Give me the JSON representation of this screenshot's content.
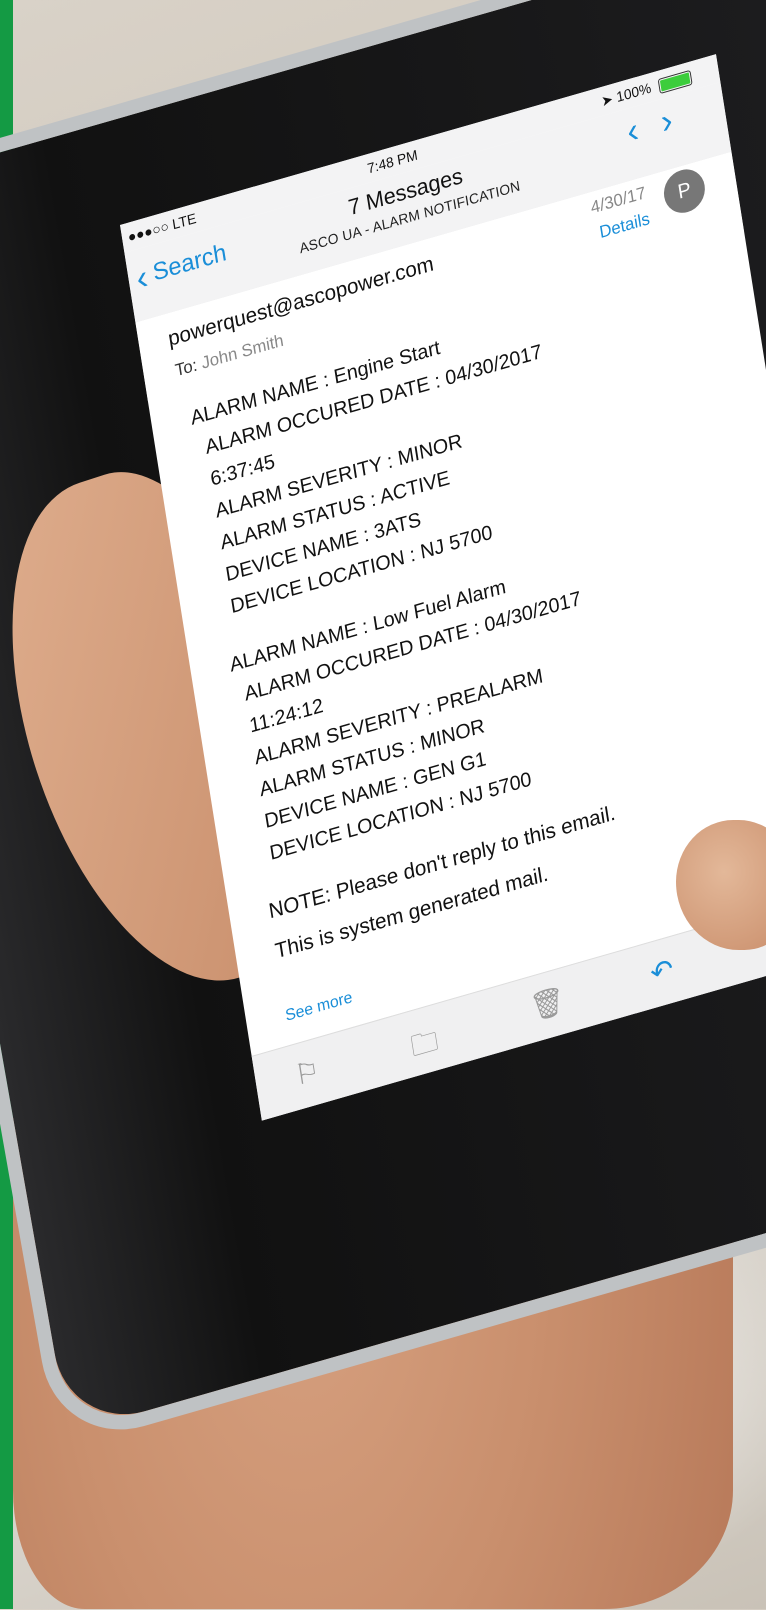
{
  "status_bar": {
    "carrier": "●●●○○ LTE",
    "time": "7:48 PM",
    "battery": "100%"
  },
  "nav": {
    "back_label": "Search",
    "title": "7 Messages",
    "subtitle": "ASCO UA - ALARM NOTIFICATION"
  },
  "email": {
    "sender": "powerquest@ascopower.com",
    "to_label": "To:",
    "to_name": "John Smith",
    "date": "4/30/17",
    "details_label": "Details",
    "avatar_initial": "P",
    "alarms": [
      {
        "name": "ALARM NAME : Engine Start",
        "occurred": "ALARM OCCURED DATE : 04/30/2017",
        "time": "6:37:45",
        "severity": "ALARM SEVERITY : MINOR",
        "status": "ALARM STATUS : ACTIVE",
        "device": "DEVICE NAME : 3ATS",
        "location": "DEVICE LOCATION : NJ 5700"
      },
      {
        "name": "ALARM NAME : Low Fuel Alarm",
        "occurred": "ALARM OCCURED DATE : 04/30/2017",
        "time": "11:24:12",
        "severity": "ALARM SEVERITY : PREALARM",
        "status": "ALARM STATUS : MINOR",
        "device": "DEVICE NAME : GEN G1",
        "location": "DEVICE LOCATION : NJ 5700"
      }
    ],
    "note_line1": "NOTE: Please don't reply to this email.",
    "note_line2": "This is system generated mail.",
    "see_more": "See more"
  },
  "toolbar": {
    "flag_icon": "flag-icon",
    "folder_icon": "folder-icon",
    "trash_icon": "trash-icon",
    "reply_icon": "reply-icon"
  },
  "colors": {
    "accent": "#1a8ed8",
    "green_bar": "#149a44",
    "avatar_bg": "#777777"
  }
}
